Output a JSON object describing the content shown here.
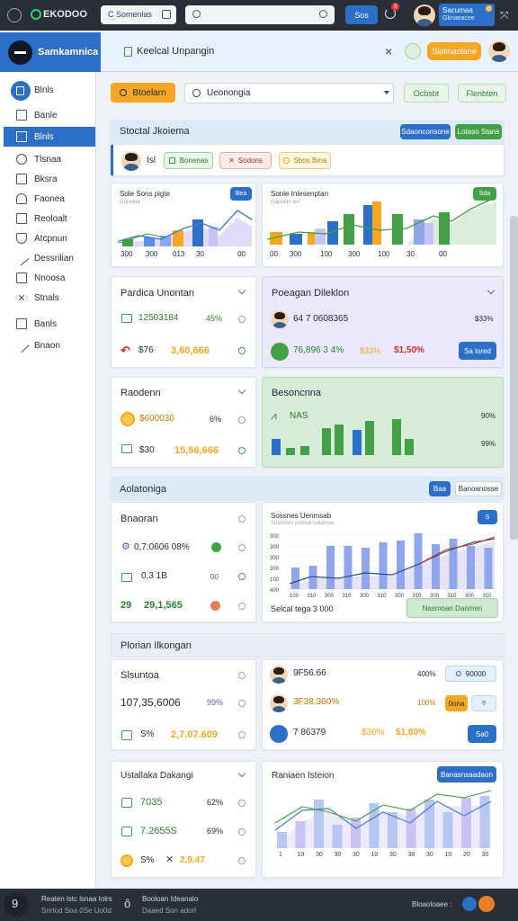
{
  "topbar": {
    "logo": "EKODOO",
    "search_label": "C Somenlas",
    "search_value": "",
    "btn_label": "Sos",
    "notif_count": "3",
    "user_name": "Sacumaa",
    "user_sub": "Gknaeacee"
  },
  "appbar": {
    "title": "Samkamnica",
    "breadcrumb": "Keelcal Unpangin",
    "primary_btn": "Slolmaolane"
  },
  "sidebar": {
    "items": [
      {
        "label": "Blnls"
      },
      {
        "label": "Banle"
      },
      {
        "label": "Blnls"
      },
      {
        "label": "Tlsnaa"
      },
      {
        "label": "Bksra"
      },
      {
        "label": "Faonea"
      },
      {
        "label": "Reoloalt"
      },
      {
        "label": "Atcpnun"
      },
      {
        "label": "Dessrilian"
      },
      {
        "label": "Nnoosa"
      },
      {
        "label": "Stnals"
      },
      {
        "label": "Banls"
      },
      {
        "label": "Bnaon"
      }
    ]
  },
  "toolbar": {
    "action_btn": "Btoelarn",
    "select_value": "Ueonongia",
    "btn_a": "Ocbsbt",
    "btn_b": "Flenbten"
  },
  "section1": {
    "title": "Stoctal Jkoiema",
    "btn_a": "Sdaonconsone",
    "btn_b": "Lotaso Stans",
    "user": "Isl",
    "chip_a": "Bonenas",
    "chip_b": "Sodons",
    "chip_c": "Sbos Bma"
  },
  "chart1": {
    "title": "Sole Sons pigte",
    "sub": "Ganeela",
    "btn": "Bea",
    "ticks": [
      "300",
      "300",
      "013",
      "30",
      "00"
    ]
  },
  "chart2": {
    "title": "Sonle Inlesenptan",
    "sub": "Gapelan tes",
    "btn": "Sda",
    "ticks": [
      "00",
      "300",
      "100",
      "300",
      "100",
      "30",
      "00"
    ]
  },
  "panel1": {
    "title": "Pardica Unontan",
    "row1_value": "12503184",
    "row1_pct": "45%",
    "row2_a": "$76",
    "row2_value": "3,60,666"
  },
  "panel2": {
    "title": "Poeagan Dileklon",
    "row1_value": "64 7 0608365",
    "row1_pct": "$33%",
    "row2_a": "76,896 3 4%",
    "row2_b": "$33%",
    "row2_c": "$1,50%",
    "btn": "Sa lored"
  },
  "panel3": {
    "title": "Raodenn",
    "row1_value": "$600030",
    "row1_pct": "6%",
    "row2_a": "$30",
    "row2_value": "15,56,666"
  },
  "panel4": {
    "title": "Besoncnna",
    "label": "NAS",
    "pct_a": "90%",
    "pct_b": "99%"
  },
  "section2": {
    "title": "Aolatoniga",
    "btn_a": "Baa",
    "btn_b": "Banoanosse"
  },
  "panel5": {
    "title": "Bnaoran",
    "row1": "0,7:0606 08%",
    "row2": "0,3 1B",
    "row2_b": "00",
    "row3_a": "29",
    "row3": "29,1,565"
  },
  "chart3": {
    "title": "Sossnes Uenmsab",
    "sub": "Suamnes prmbal natamsa",
    "btn": "S",
    "yticks": [
      "300",
      "300",
      "300",
      "300",
      "100",
      "400"
    ],
    "xticks": [
      "100",
      "310",
      "300",
      "310",
      "300",
      "310",
      "300",
      "310",
      "300",
      "310",
      "300",
      "310"
    ],
    "footer": "Selcal tega 3 000",
    "footer_btn": "Nasmoan Danmen"
  },
  "section3": {
    "title": "Plorian Ilkongan"
  },
  "panel6": {
    "title": "Slsuntoa",
    "row1": "107,35,6006",
    "row1_pct": "99%",
    "row2_a": "S%",
    "row2": "2,7.07.609"
  },
  "panel7": {
    "row1_value": "9F56.66",
    "row1_pct": "400%",
    "row1_btn": "90000",
    "row2_value": "3F38.360%",
    "row2_btn": "0ona",
    "row2_pct": "100%",
    "row3_value": "7 86379",
    "row3_pct": "$36%",
    "row3_b": "$1,80%",
    "row3_btn": "Sa0"
  },
  "panel8": {
    "title": "Ustallaka Dakangi",
    "row1": "7035",
    "row1_pct": "62%",
    "row2": "7.2655S",
    "row2_pct": "69%",
    "row3_a": "S%",
    "row3": "2.9.47"
  },
  "chart4": {
    "title": "Raniaen Isteion",
    "btn": "Banasnsaadaon",
    "xticks": [
      "1",
      "10",
      "30",
      "30",
      "30",
      "10",
      "30",
      "30",
      "30",
      "10",
      "20",
      "30"
    ]
  },
  "footer": {
    "text_a": "Reaten lstc lsnaa Iolrs",
    "text_b": "Snrtod Soa 0Se Uo0d",
    "text_c": "Booloan Ideanalo",
    "text_d": "Daaed Son adorl",
    "right": "Bloaoloaee :"
  },
  "colors": {
    "primary": "#2c6fc9",
    "accent_orange": "#f5a623",
    "green": "#43a047",
    "chart_blue": "#8fa6ee",
    "chart_purple": "#c9c3f5"
  }
}
